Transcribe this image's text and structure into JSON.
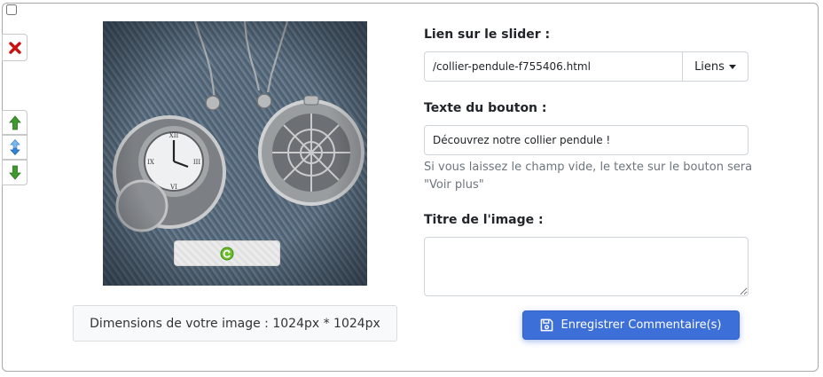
{
  "icons": {
    "delete": "close-icon",
    "move_up": "arrow-up-icon",
    "move_up_down": "arrow-up-down-icon",
    "move_down": "arrow-down-icon",
    "refresh": "refresh-icon",
    "save": "floppy-disk-icon",
    "links_caret": "caret-down-icon"
  },
  "colors": {
    "delete_red": "#cc1010",
    "arrow_green": "#3c9a2c",
    "arrow_blue": "#2f86d8",
    "save_button": "#3d6fd9"
  },
  "image_panel": {
    "dimensions_text": "Dimensions de votre image : 1024px * 1024px"
  },
  "form": {
    "link_label": "Lien sur le slider :",
    "link_value": "/collier-pendule-f755406.html",
    "links_button": "Liens",
    "button_text_label": "Texte du bouton :",
    "button_text_value": "Découvrez notre collier pendule !",
    "button_text_help": "Si vous laissez le champ vide, le texte sur le bouton sera \"Voir plus\"",
    "image_title_label": "Titre de l'image :",
    "image_title_value": "",
    "save_button": "Enregistrer Commentaire(s)"
  }
}
